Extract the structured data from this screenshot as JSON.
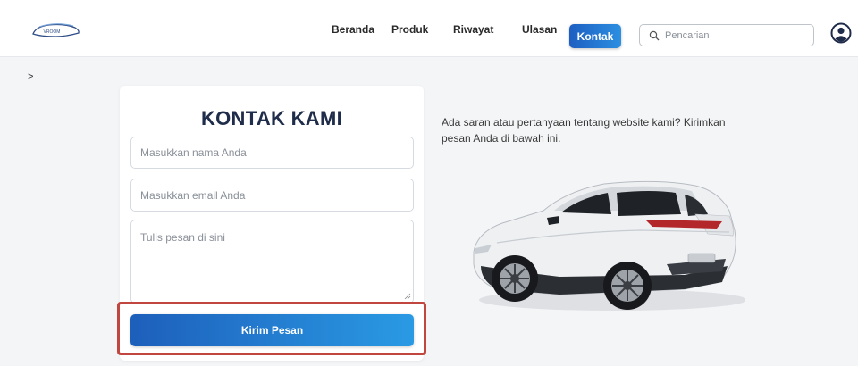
{
  "header": {
    "logo_text": "VROOM",
    "nav": {
      "beranda": "Beranda",
      "produk": "Produk",
      "riwayat": "Riwayat",
      "ulasan": "Ulasan",
      "kontak": "Kontak"
    },
    "search_placeholder": "Pencarian",
    "active_tab": "Kontak"
  },
  "breadcrumb": ">",
  "form": {
    "title": "KONTAK KAMI",
    "name_placeholder": "Masukkan nama Anda",
    "email_placeholder": "Masukkan email Anda",
    "message_placeholder": "Tulis pesan di sini",
    "submit_label": "Kirim Pesan"
  },
  "info": {
    "text": "Ada saran atau pertanyaan tentang website kami? Kirimkan pesan Anda di bawah ini."
  },
  "icons": {
    "search": "search-icon",
    "avatar": "user-avatar-icon",
    "car": "suv-car-image"
  },
  "colors": {
    "accent_start": "#1d5fbb",
    "accent_end": "#2a9ae4",
    "title": "#1f2c4a",
    "highlight": "#c0463f"
  }
}
